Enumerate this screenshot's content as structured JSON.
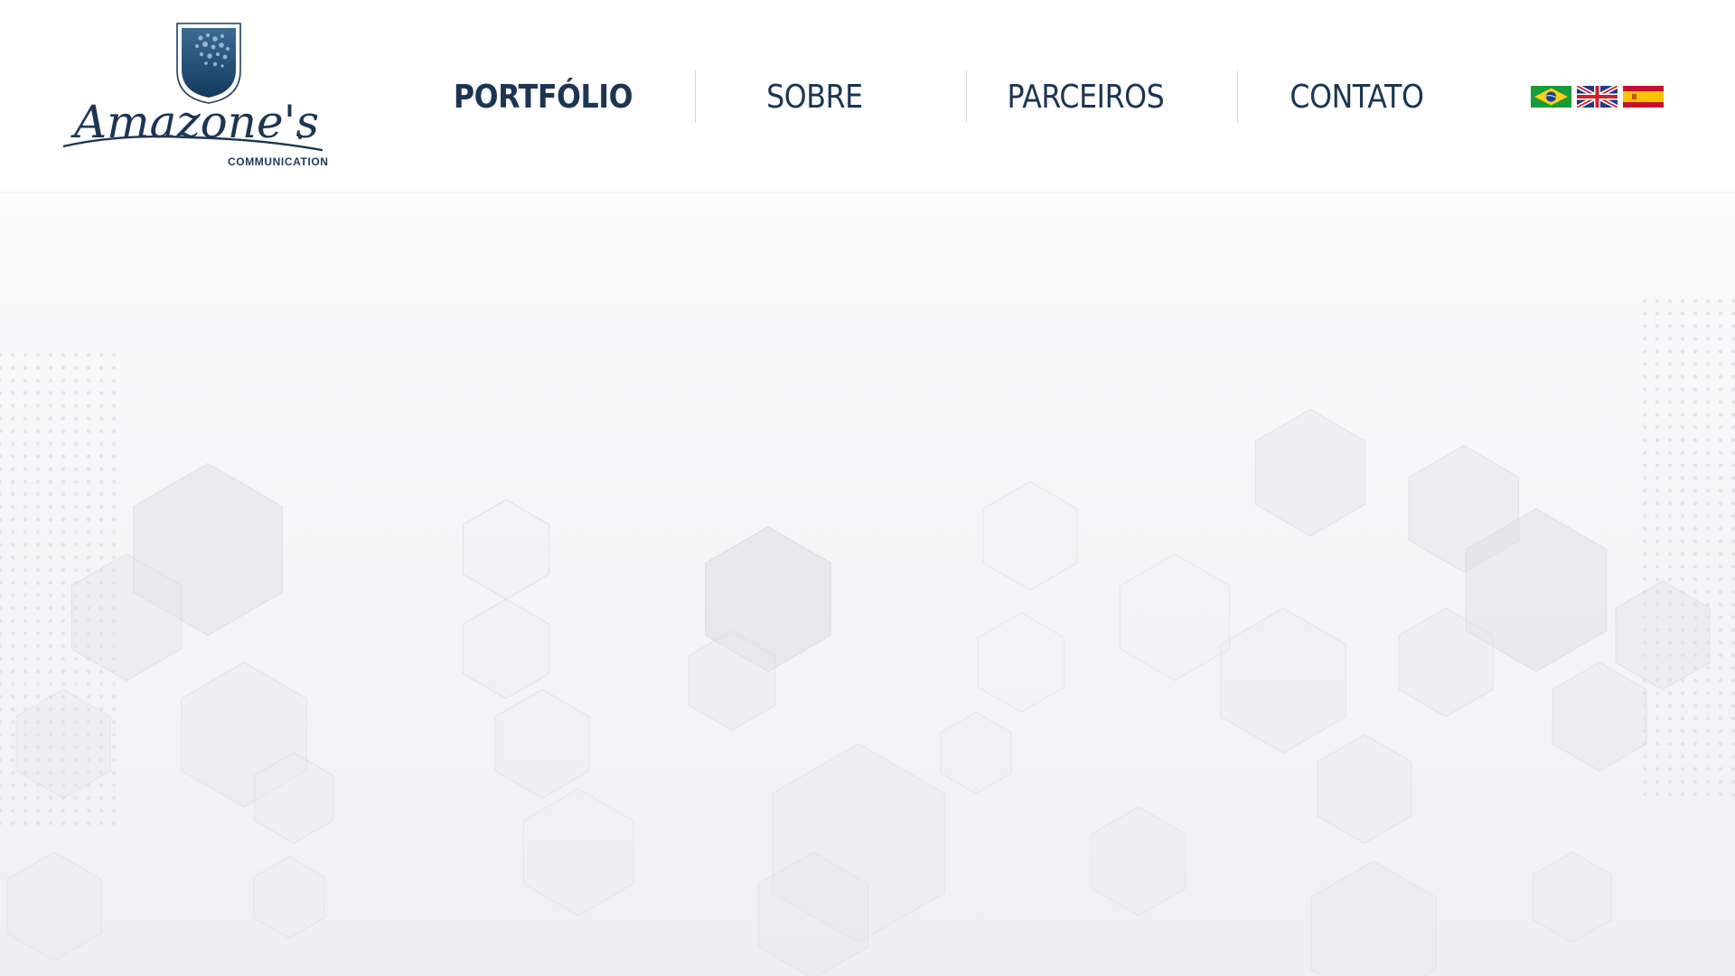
{
  "brand": {
    "name": "Amazone's",
    "subtitle": "COMMUNICATION",
    "colors": {
      "primary": "#1c3553",
      "shield": "#1f4f78"
    }
  },
  "nav": {
    "items": [
      {
        "label": "PORTFÓLIO",
        "active": true
      },
      {
        "label": "SOBRE",
        "active": false
      },
      {
        "label": "PARCEIROS",
        "active": false
      },
      {
        "label": "CONTATO",
        "active": false
      }
    ]
  },
  "languages": [
    {
      "icon": "brazil-flag-icon",
      "code": "pt"
    },
    {
      "icon": "uk-flag-icon",
      "code": "en"
    },
    {
      "icon": "spain-flag-icon",
      "code": "es"
    }
  ],
  "hero": {
    "background": "hexagon-pattern",
    "colors": {
      "base": "#f3f4f6",
      "hex": "#dfe2e6"
    }
  }
}
